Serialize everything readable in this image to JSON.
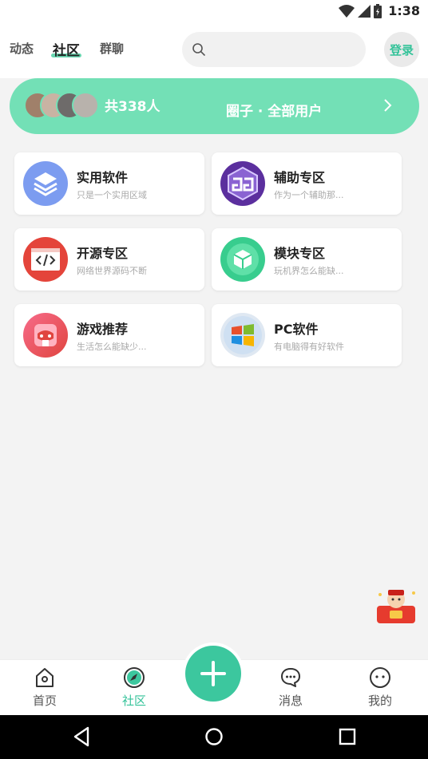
{
  "status_bar": {
    "time": "1:38"
  },
  "header": {
    "tabs": [
      {
        "label": "动态"
      },
      {
        "label": "社区"
      },
      {
        "label": "群聊"
      }
    ],
    "search": {
      "placeholder": ""
    },
    "login_label": "登录"
  },
  "banner": {
    "member_count": "共338人",
    "title": "圈子 · 全部用户"
  },
  "categories": [
    {
      "title": "实用软件",
      "desc": "只是一个实用区域",
      "icon": "layers-icon",
      "color": "#6f8ee8"
    },
    {
      "title": "辅助专区",
      "desc": "作为一个辅助那...",
      "icon": "gg-logo-icon",
      "color": "#6a3fb5"
    },
    {
      "title": "开源专区",
      "desc": "网络世界源码不断",
      "icon": "code-icon",
      "color": "#e8473b"
    },
    {
      "title": "模块专区",
      "desc": "玩机界怎么能缺...",
      "icon": "cube-icon",
      "color": "#39cf8f"
    },
    {
      "title": "游戏推荐",
      "desc": "生活怎么能缺少...",
      "icon": "gamepad-icon",
      "color": "#f0506e"
    },
    {
      "title": "PC软件",
      "desc": "有电脑得有好软件",
      "icon": "windows-logo-icon",
      "color": "#2d7fd6"
    }
  ],
  "bottom_nav": [
    {
      "label": "首页",
      "icon": "home-icon"
    },
    {
      "label": "社区",
      "icon": "compass-icon"
    },
    {
      "label": "消息",
      "icon": "chat-icon"
    },
    {
      "label": "我的",
      "icon": "face-icon"
    }
  ],
  "colors": {
    "accent": "#3cc79e",
    "banner": "#73e0b6"
  }
}
